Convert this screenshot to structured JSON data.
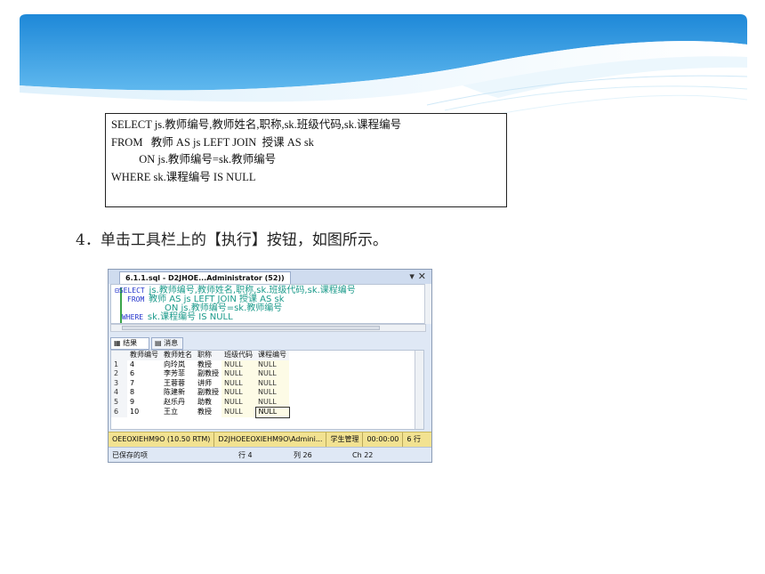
{
  "sql_box": {
    "lines": [
      "SELECT js.教师编号,教师姓名,职称,sk.班级代码,sk.课程编号",
      "FROM   教师 AS js LEFT JOIN  授课 AS sk",
      "          ON js.教师编号=sk.教师编号",
      "WHERE sk.课程编号 IS NULL"
    ]
  },
  "step": {
    "number": "4．",
    "text": "单击工具栏上的【执行】按钮，如图所示。"
  },
  "screenshot": {
    "tab_title": "6.1.1.sql - D2JHOE...Administrator (52))",
    "tab_controls": "▾ ✕",
    "editor": {
      "line1_kw": "⊟SELECT",
      "line1_rest": "js.教师编号,教师姓名,职称,sk.班级代码,sk.课程编号",
      "line2_kw": "FROM",
      "line2_rest": "教师 AS js LEFT JOIN  授课 AS sk",
      "line3": "ON js.教师编号=sk.教师编号",
      "line4_kw": "WHERE",
      "line4_rest": "sk.课程编号 IS NULL"
    },
    "result_tabs": [
      "结果",
      "消息"
    ],
    "columns": [
      "教师编号",
      "教师姓名",
      "职称",
      "班级代码",
      "课程编号"
    ],
    "rows": [
      {
        "n": "1",
        "id": "4",
        "name": "向玲岚",
        "title": "教授",
        "class": "NULL",
        "course": "NULL"
      },
      {
        "n": "2",
        "id": "6",
        "name": "李芳菲",
        "title": "副教授",
        "class": "NULL",
        "course": "NULL"
      },
      {
        "n": "3",
        "id": "7",
        "name": "王蓉蓉",
        "title": "讲师",
        "class": "NULL",
        "course": "NULL"
      },
      {
        "n": "4",
        "id": "8",
        "name": "陈建新",
        "title": "副教授",
        "class": "NULL",
        "course": "NULL"
      },
      {
        "n": "5",
        "id": "9",
        "name": "赵乐丹",
        "title": "助教",
        "class": "NULL",
        "course": "NULL"
      },
      {
        "n": "6",
        "id": "10",
        "name": "王立",
        "title": "教授",
        "class": "NULL",
        "course": "NULL"
      }
    ],
    "status_bar": [
      "OEEOXIEHM9O (10.50 RTM)",
      "D2JHOEEOXIEHM9O\\Admini...",
      "学生管理",
      "00:00:00",
      "6 行"
    ],
    "bottom_bar": {
      "left": "已保存的项",
      "row": "行 4",
      "col": "列 26",
      "ch": "Ch 22"
    }
  }
}
